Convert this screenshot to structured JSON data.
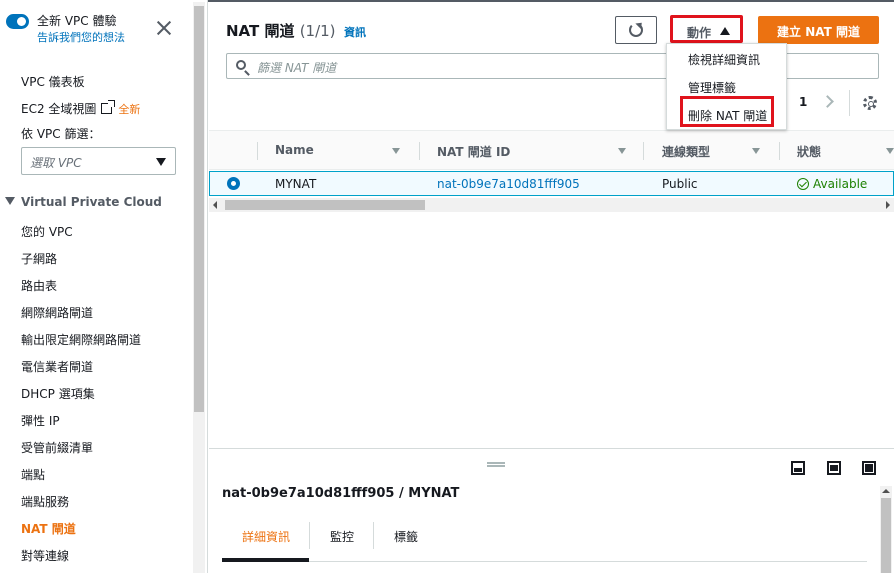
{
  "sidebar": {
    "toggle_title": "全新 VPC 體驗",
    "toggle_link": "告訴我們您的想法",
    "items": [
      {
        "label": "VPC 儀表板"
      },
      {
        "label": "EC2 全域視圖",
        "badge": "全新"
      },
      {
        "label": "依 VPC 篩選："
      }
    ],
    "filter_placeholder": "選取 VPC",
    "section_title": "Virtual Private Cloud",
    "nav": [
      {
        "label": "您的 VPC"
      },
      {
        "label": "子網路"
      },
      {
        "label": "路由表"
      },
      {
        "label": "網際網路閘道"
      },
      {
        "label": "輸出限定網際網路閘道"
      },
      {
        "label": "電信業者閘道"
      },
      {
        "label": "DHCP 選項集"
      },
      {
        "label": "彈性 IP"
      },
      {
        "label": "受管前綴清單"
      },
      {
        "label": "端點"
      },
      {
        "label": "端點服務"
      },
      {
        "label": "NAT 閘道",
        "active": true
      },
      {
        "label": "對等連線"
      }
    ]
  },
  "header": {
    "title": "NAT 閘道",
    "count": "(1/1)",
    "info_link": "資訊",
    "actions_label": "動作",
    "create_label": "建立 NAT 閘道",
    "search_placeholder": "篩選 NAT 閘道"
  },
  "actions_menu": {
    "items": [
      "檢視詳細資訊",
      "管理標籤",
      "刪除 NAT 閘道"
    ],
    "highlighted_item": "刪除 NAT 閘道"
  },
  "pagination": {
    "current_page": "1"
  },
  "table": {
    "columns": [
      "Name",
      "NAT 閘道 ID",
      "連線類型",
      "狀態"
    ],
    "rows": [
      {
        "name": "MYNAT",
        "id": "nat-0b9e7a10d81fff905",
        "type": "Public",
        "status": "Available",
        "selected": true
      }
    ]
  },
  "split_panel": {
    "title": "nat-0b9e7a10d81fff905 / MYNAT",
    "tabs": [
      "詳細資訊",
      "監控",
      "標籤"
    ],
    "active_tab": "詳細資訊"
  },
  "colors": {
    "accent": "#ec7211",
    "link": "#0073bb",
    "highlight_box": "#e0131c",
    "status_ok": "#1d8102"
  }
}
